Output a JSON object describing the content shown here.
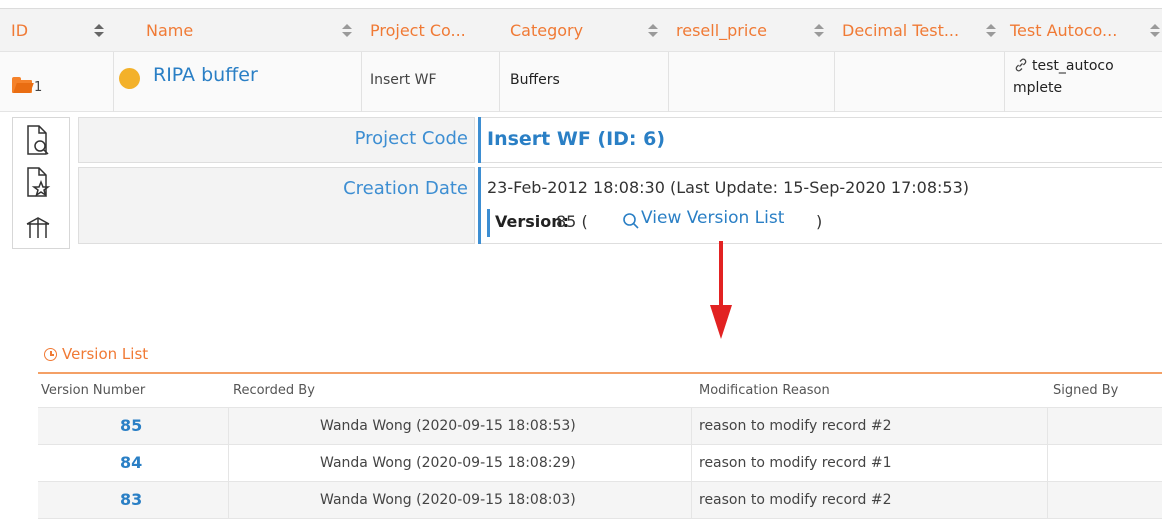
{
  "grid": {
    "columns": [
      {
        "label": "ID"
      },
      {
        "label": "Name"
      },
      {
        "label": "Project Co..."
      },
      {
        "label": "Category"
      },
      {
        "label": "resell_price"
      },
      {
        "label": "Decimal Test..."
      },
      {
        "label": "Test Autoco..."
      }
    ],
    "row": {
      "id": "1",
      "name": "RIPA buffer",
      "project_code": "Insert WF",
      "category": "Buffers",
      "resell_price": "",
      "decimal_test": "",
      "test_autocomplete_line1": "test_autoco",
      "test_autocomplete_line2": "mplete",
      "status_color": "#f3b12a"
    }
  },
  "details": {
    "project_code_label": "Project Code",
    "project_code_value": "Insert WF (ID: 6)",
    "creation_date_label": "Creation Date",
    "creation_date_value": "23-Feb-2012 18:08:30 (Last Update: 15-Sep-2020 17:08:53)",
    "version_label": "Version:",
    "version_number": "85 (",
    "version_link": "View Version List",
    "version_close": ")"
  },
  "version_list": {
    "title": "Version List",
    "headers": [
      "Version Number",
      "Recorded By",
      "Modification Reason",
      "Signed By"
    ],
    "rows": [
      {
        "number": "85",
        "recorded_by": "Wanda Wong (2020-09-15 18:08:53)",
        "reason": "reason to modify record #2",
        "signed_by": ""
      },
      {
        "number": "84",
        "recorded_by": "Wanda Wong (2020-09-15 18:08:29)",
        "reason": "reason to modify record #1",
        "signed_by": ""
      },
      {
        "number": "83",
        "recorded_by": "Wanda Wong (2020-09-15 18:08:03)",
        "reason": "reason to modify record #2",
        "signed_by": ""
      }
    ]
  },
  "colors": {
    "accent_orange": "#f07a35",
    "link_blue": "#2a7fc5",
    "arrow_red": "#e22222"
  }
}
